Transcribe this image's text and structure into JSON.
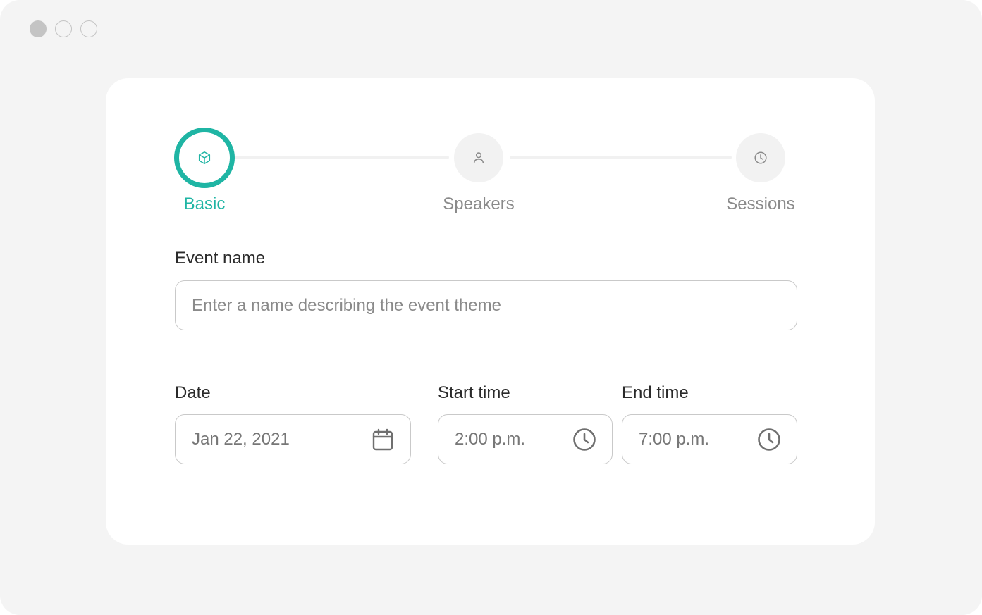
{
  "window": {
    "controls": [
      "close",
      "minimize",
      "maximize"
    ]
  },
  "stepper": {
    "steps": [
      {
        "label": "Basic",
        "icon": "cube-icon",
        "state": "active"
      },
      {
        "label": "Speakers",
        "icon": "user-icon",
        "state": "inactive"
      },
      {
        "label": "Sessions",
        "icon": "clock-icon",
        "state": "inactive"
      }
    ]
  },
  "form": {
    "event_name": {
      "label": "Event name",
      "placeholder": "Enter a name describing the event theme",
      "value": ""
    },
    "date": {
      "label": "Date",
      "value": "Jan 22, 2021",
      "icon": "calendar-icon"
    },
    "start_time": {
      "label": "Start time",
      "value": "2:00 p.m.",
      "icon": "clock-icon"
    },
    "end_time": {
      "label": "End time",
      "value": "7:00 p.m.",
      "icon": "clock-icon"
    }
  },
  "colors": {
    "accent": "#1fb5a4",
    "window_bg": "#f4f4f4",
    "card_bg": "#ffffff",
    "muted_text": "#8a8a8a",
    "border": "#c9c9c9"
  }
}
